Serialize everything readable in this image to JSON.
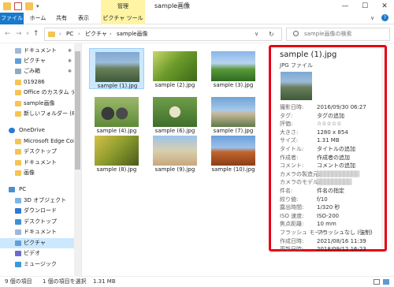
{
  "window": {
    "tools_label": "管理",
    "title": "sample画像",
    "minimize": "—",
    "maximize": "☐",
    "close": "✕"
  },
  "ribbon": {
    "tabs": [
      "ファイル",
      "ホーム",
      "共有",
      "表示",
      "ピクチャ ツール"
    ]
  },
  "address": {
    "back": "←",
    "forward": "→",
    "up": "↑",
    "sep": "›",
    "crumbs": [
      "PC",
      "ピクチャ",
      "sample画像"
    ],
    "dropdown": "∨",
    "refresh": "↻"
  },
  "search": {
    "placeholder": "sample画像の検索"
  },
  "sidebar": {
    "items": [
      {
        "label": "ドキュメント",
        "pinned": "✱"
      },
      {
        "label": "ピクチャ",
        "pinned": "✱"
      },
      {
        "label": "ごみ箱",
        "pinned": "✱"
      },
      {
        "label": "019286",
        "pinned": ""
      },
      {
        "label": "Office のカスタム テンプレ",
        "pinned": ""
      },
      {
        "label": "sample画像",
        "pinned": ""
      },
      {
        "label": "新しいフォルダー (8)",
        "pinned": ""
      },
      {
        "label": "OneDrive",
        "pinned": ""
      },
      {
        "label": "Microsoft Edge Colle",
        "pinned": ""
      },
      {
        "label": "デスクトップ",
        "pinned": ""
      },
      {
        "label": "ドキュメント",
        "pinned": ""
      },
      {
        "label": "画像",
        "pinned": ""
      },
      {
        "label": "PC",
        "pinned": ""
      },
      {
        "label": "3D オブジェクト",
        "pinned": ""
      },
      {
        "label": "ダウンロード",
        "pinned": ""
      },
      {
        "label": "デスクトップ",
        "pinned": ""
      },
      {
        "label": "ドキュメント",
        "pinned": ""
      },
      {
        "label": "ピクチャ",
        "pinned": ""
      },
      {
        "label": "ビデオ",
        "pinned": ""
      },
      {
        "label": "ミュージック",
        "pinned": ""
      }
    ]
  },
  "files": [
    {
      "name": "sample (1).jpg",
      "selected": true
    },
    {
      "name": "sample (2).jpg",
      "selected": false
    },
    {
      "name": "sample (3).jpg",
      "selected": false
    },
    {
      "name": "sample (4).jpg",
      "selected": false
    },
    {
      "name": "sample (6).jpg",
      "selected": false
    },
    {
      "name": "sample (7).jpg",
      "selected": false
    },
    {
      "name": "sample (8).jpg",
      "selected": false
    },
    {
      "name": "sample (9).jpg",
      "selected": false
    },
    {
      "name": "sample (10).jpg",
      "selected": false
    }
  ],
  "details": {
    "name": "sample (1).jpg",
    "type": "JPG ファイル",
    "properties": [
      {
        "label": "撮影日時:",
        "value": "2016/09/30 06:27"
      },
      {
        "label": "タグ:",
        "value": "タグの追加"
      },
      {
        "label": "評価:",
        "value": "☆☆☆☆☆"
      },
      {
        "label": "大きさ:",
        "value": "1280 x 854"
      },
      {
        "label": "サイズ:",
        "value": "1.31 MB"
      },
      {
        "label": "タイトル:",
        "value": "タイトルの追加"
      },
      {
        "label": "作成者:",
        "value": "作成者の追加"
      },
      {
        "label": "コメント:",
        "value": "コメントの追加"
      },
      {
        "label": "カメラの製造元:",
        "value": "▒▒▒▒▒▒▒▒▒▒▒"
      },
      {
        "label": "カメラのモデル:",
        "value": "▒▒▒▒▒▒▒▒▒"
      },
      {
        "label": "件名:",
        "value": "件名の指定"
      },
      {
        "label": "絞り値:",
        "value": "f/10"
      },
      {
        "label": "露出時間:",
        "value": "1/320 秒"
      },
      {
        "label": "ISO 速度:",
        "value": "ISO-200"
      },
      {
        "label": "焦点距離:",
        "value": "10 mm"
      },
      {
        "label": "フラッシュ モード:",
        "value": "フラッシュなし (強制)"
      },
      {
        "label": "作成日時:",
        "value": "2021/08/16 11:39"
      },
      {
        "label": "更新日時:",
        "value": "2018/09/12 16:23"
      }
    ]
  },
  "status": {
    "count": "9 個の項目",
    "selection": "1 個の項目を選択",
    "size": "1.31 MB"
  }
}
